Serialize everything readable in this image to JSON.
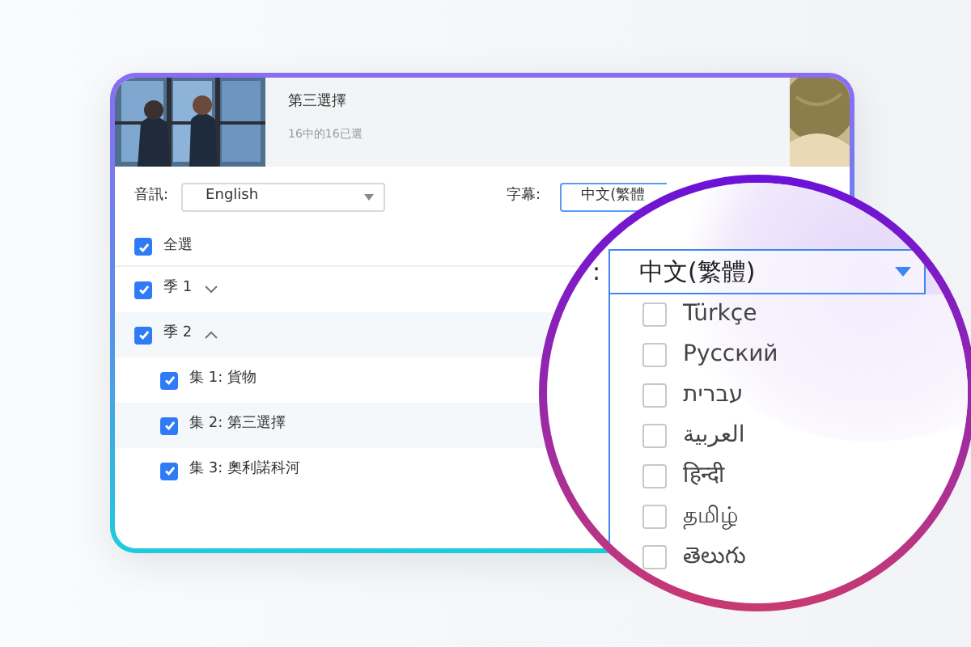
{
  "episode": {
    "title": "第三選擇",
    "progress": "16中的16已選"
  },
  "audio": {
    "label": "音訊:",
    "value": "English"
  },
  "subtitle": {
    "label": "字幕:",
    "value": "中文(繁體"
  },
  "select_all": {
    "label": "全選",
    "checked": true
  },
  "seasons": [
    {
      "label": "季 1",
      "checked": true,
      "expanded": false
    },
    {
      "label": "季 2",
      "checked": true,
      "expanded": true,
      "children": [
        {
          "label": "集 1: 貨物",
          "checked": true
        },
        {
          "label": "集 2: 第三選擇",
          "checked": true
        },
        {
          "label": "集 3: 奧利諾科河",
          "checked": true
        }
      ]
    }
  ],
  "magnifier": {
    "label": ":",
    "value": "中文(繁體)",
    "options": [
      {
        "label": "Türkçe",
        "checked": false
      },
      {
        "label": "Русский",
        "checked": false
      },
      {
        "label": "עברית",
        "checked": false
      },
      {
        "label": "العربية",
        "checked": false
      },
      {
        "label": "हिन्दी",
        "checked": false
      },
      {
        "label": "தமிழ்",
        "checked": false
      },
      {
        "label": "తెలుగు",
        "checked": false
      }
    ]
  }
}
